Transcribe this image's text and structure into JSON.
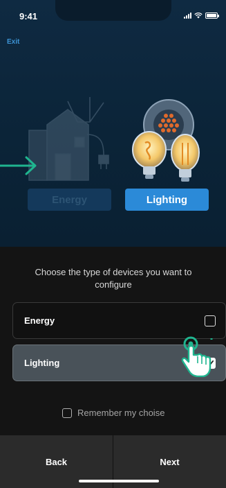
{
  "status_bar": {
    "time": "9:41"
  },
  "header": {
    "exit_label": "Exit"
  },
  "hero": {
    "energy_label": "Energy",
    "lighting_label": "Lighting"
  },
  "sheet": {
    "question": "Choose the type of devices you want to configure",
    "options": [
      {
        "label": "Energy",
        "checked": false
      },
      {
        "label": "Lighting",
        "checked": true
      }
    ],
    "remember_label": "Remember my choise",
    "remember_checked": false
  },
  "footer": {
    "back_label": "Back",
    "next_label": "Next"
  },
  "colors": {
    "accent": "#2b8ad8",
    "hint_arrow": "#1fb58f",
    "hero_bg": "#0f2a42",
    "sheet_bg": "#141414"
  }
}
